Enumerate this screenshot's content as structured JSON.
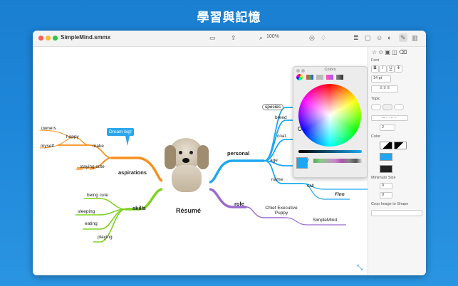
{
  "headline": "學習與記憶",
  "window": {
    "title": "SimpleMind.smmx",
    "zoom": "100%"
  },
  "canvas": {
    "central": "Résumé",
    "aspirations": {
      "label": "aspirations",
      "children": [
        "make",
        "happy",
        "owners",
        "myself",
        "staying cute"
      ],
      "callout": "Dream big!"
    },
    "skills": {
      "label": "skills",
      "children": [
        "being cute",
        "sleeping",
        "eating",
        "playing"
      ]
    },
    "personal": {
      "label": "personal",
      "children": [
        "species",
        "breed",
        "coat",
        "age",
        "name"
      ]
    },
    "role": {
      "label": "role",
      "children": [
        "Chief Executive Puppy",
        "SimpleMind"
      ]
    },
    "call": "call",
    "finn": "Finn"
  },
  "colors_panel": {
    "title": "Colors"
  },
  "inspector": {
    "font_label": "Font",
    "font_styles": [
      "B",
      "I",
      "U",
      "T"
    ],
    "font_size": "14 pt",
    "topic_label": "Topic",
    "border_width": "2",
    "color_label": "Color",
    "min_size_label": "Minimum Size",
    "min_w": "0",
    "min_h": "0",
    "crop_label": "Crop Image to Shape"
  },
  "colors": {
    "orange": "#f5901e",
    "green": "#7ed321",
    "blue": "#1ea7f0",
    "purple": "#9b6bd0",
    "accent": "#1e86d8"
  }
}
